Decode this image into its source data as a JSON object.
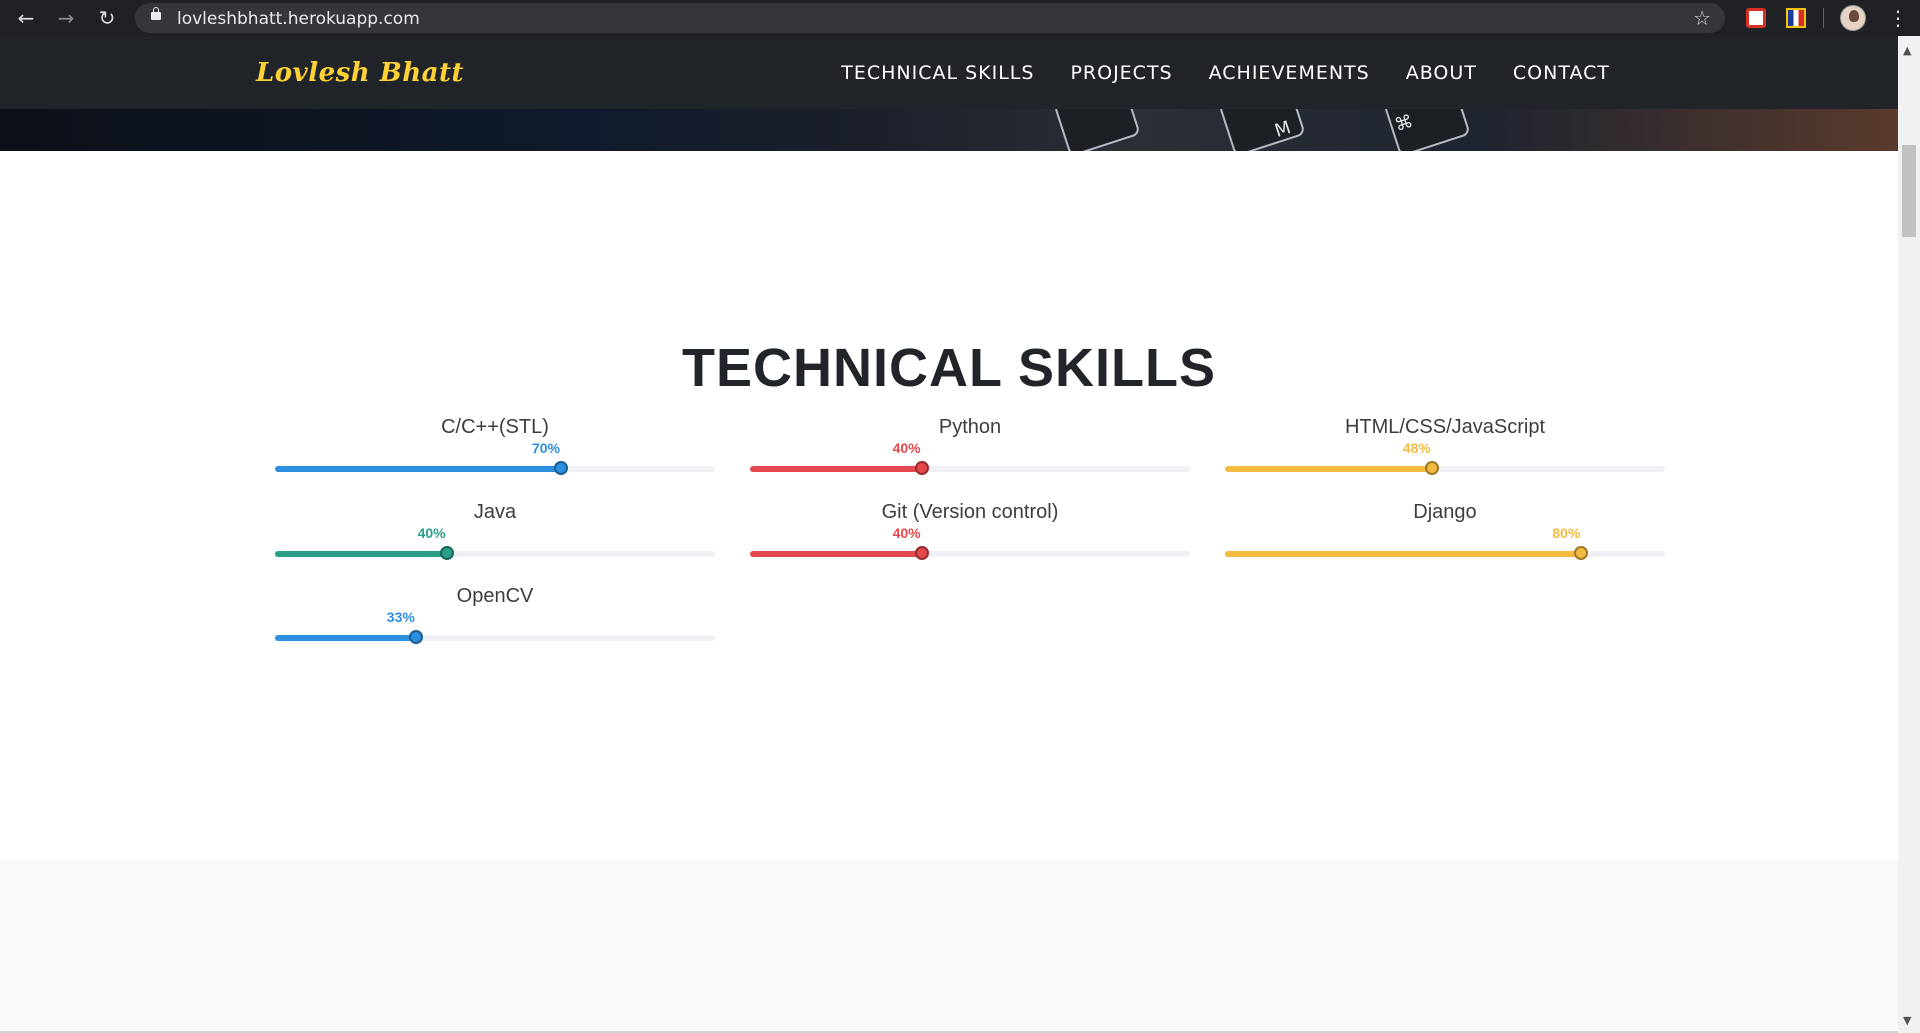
{
  "browser": {
    "url": "lovleshbhatt.herokuapp.com",
    "back_icon": "back-arrow-icon",
    "forward_icon": "forward-arrow-icon",
    "reload_icon": "reload-icon"
  },
  "navbar": {
    "brand": "Lovlesh Bhatt",
    "brand_color": "#fed136",
    "links": [
      {
        "label": "TECHNICAL SKILLS"
      },
      {
        "label": "PROJECTS"
      },
      {
        "label": "ACHIEVEMENTS"
      },
      {
        "label": "ABOUT"
      },
      {
        "label": "CONTACT"
      }
    ]
  },
  "skills_section": {
    "title": "TECHNICAL SKILLS",
    "skills": [
      {
        "name": "C/C++(STL)",
        "percent_label": "70%",
        "level": 0.65,
        "color": "#2c8fe0"
      },
      {
        "name": "Python",
        "percent_label": "40%",
        "level": 0.39,
        "color": "#e5484d"
      },
      {
        "name": "HTML/CSS/JavaScript",
        "percent_label": "48%",
        "level": 0.47,
        "color": "#f4bb41"
      },
      {
        "name": "Java",
        "percent_label": "40%",
        "level": 0.39,
        "color": "#2b9e8a"
      },
      {
        "name": "Git (Version control)",
        "percent_label": "40%",
        "level": 0.39,
        "color": "#e5484d"
      },
      {
        "name": "Django",
        "percent_label": "80%",
        "level": 0.81,
        "color": "#f4bb41"
      },
      {
        "name": "OpenCV",
        "percent_label": "33%",
        "level": 0.32,
        "color": "#2c8fe0"
      }
    ]
  }
}
